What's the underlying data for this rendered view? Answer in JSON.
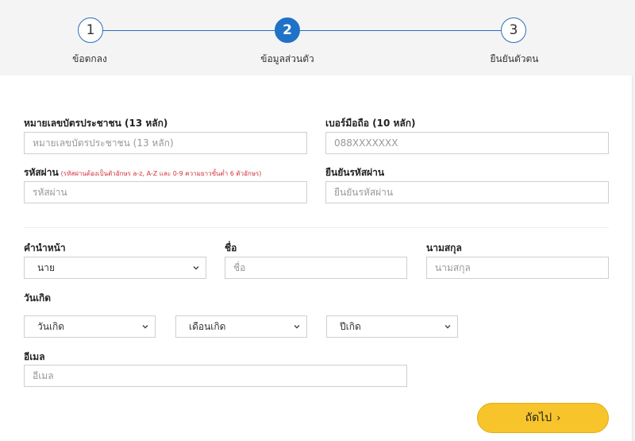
{
  "stepper": {
    "steps": [
      {
        "number": "1",
        "label": "ข้อตกลง"
      },
      {
        "number": "2",
        "label": "ข้อมูลส่วนตัว"
      },
      {
        "number": "3",
        "label": "ยืนยันตัวตน"
      }
    ],
    "active_step": 2
  },
  "form": {
    "id_card": {
      "label": "หมายเลขบัตรประชาชน (13 หลัก)",
      "placeholder": "หมายเลขบัตรประชาชน (13 หลัก)"
    },
    "mobile": {
      "label": "เบอร์มือถือ (10 หลัก)",
      "placeholder": "088XXXXXXX"
    },
    "password": {
      "label": "รหัสผ่าน",
      "hint": "(รหัสผ่านต้องเป็นตัวอักษร a-z, A-Z และ 0-9 ความยาวขั้นต่ำ 6 ตัวอักษร)",
      "placeholder": "รหัสผ่าน"
    },
    "confirm_password": {
      "label": "ยืนยันรหัสผ่าน",
      "placeholder": "ยืนยันรหัสผ่าน"
    },
    "title": {
      "label": "คำนำหน้า",
      "value": "นาย"
    },
    "first_name": {
      "label": "ชื่อ",
      "placeholder": "ชื่อ"
    },
    "last_name": {
      "label": "นามสกุล",
      "placeholder": "นามสกุล"
    },
    "birthdate": {
      "label": "วันเกิด",
      "day": "วันเกิด",
      "month": "เดือนเกิด",
      "year": "ปีเกิด"
    },
    "email": {
      "label": "อีเมล",
      "placeholder": "อีเมล"
    }
  },
  "next_button": {
    "label": "ถัดไป",
    "icon": "chevron-right-icon"
  },
  "colors": {
    "accent": "#1f72c6",
    "button": "#f7c52b",
    "hint": "#d2323c"
  }
}
